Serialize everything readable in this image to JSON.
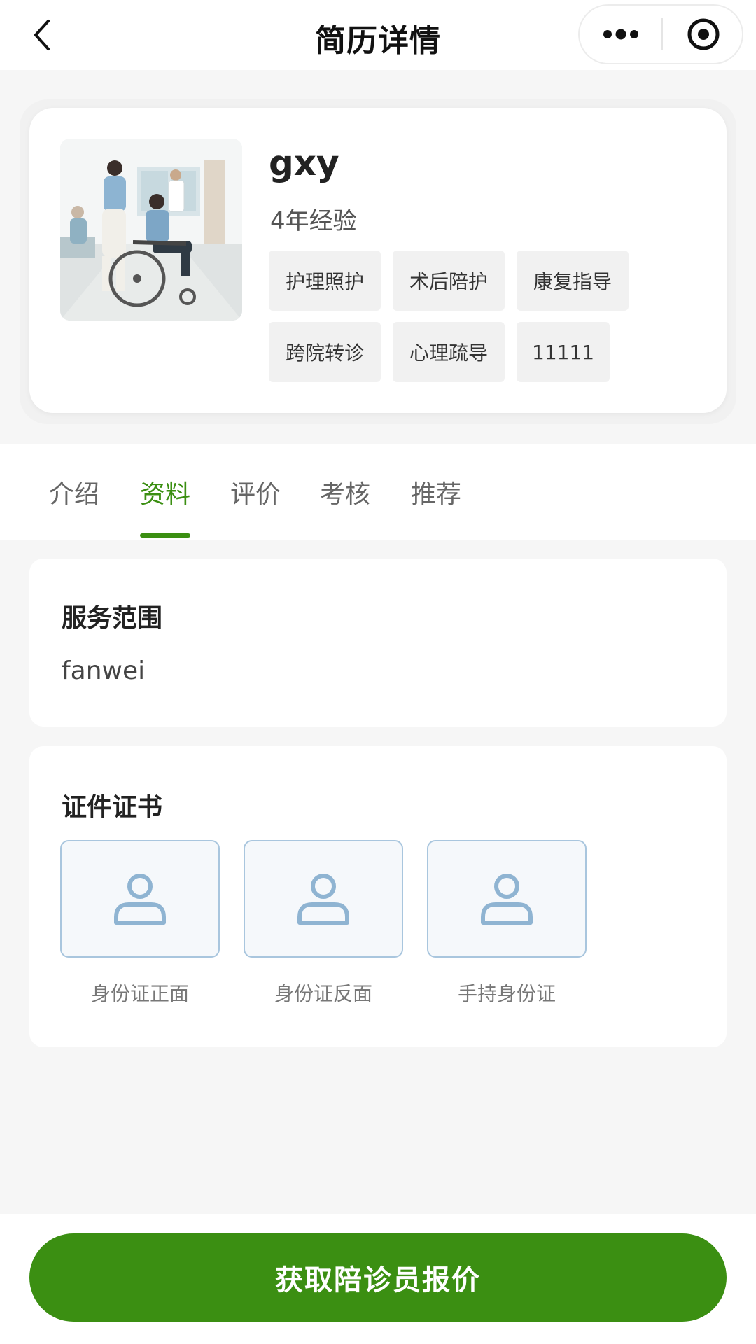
{
  "nav": {
    "title": "简历详情",
    "back_icon": "chevron-left-icon",
    "more_icon": "more-dots-icon",
    "target_icon": "target-icon"
  },
  "profile": {
    "name": "gxy",
    "experience": "4年经验",
    "tags": [
      "护理照护",
      "术后陪护",
      "康复指导",
      "跨院转诊",
      "心理疏导",
      "11111"
    ]
  },
  "tabs": [
    {
      "label": "介绍",
      "active": false
    },
    {
      "label": "资料",
      "active": true
    },
    {
      "label": "评价",
      "active": false
    },
    {
      "label": "考核",
      "active": false
    },
    {
      "label": "推荐",
      "active": false
    }
  ],
  "service_scope": {
    "title": "服务范围",
    "content": "fanwei"
  },
  "certificates": {
    "title": "证件证书",
    "items": [
      {
        "label": "身份证正面",
        "icon": "person-icon"
      },
      {
        "label": "身份证反面",
        "icon": "person-icon"
      },
      {
        "label": "手持身份证",
        "icon": "person-icon"
      }
    ]
  },
  "cta": {
    "label": "获取陪诊员报价"
  },
  "colors": {
    "accent": "#3b8f12",
    "cert_border": "#a9c6de",
    "cert_icon": "#8fb4d2"
  }
}
